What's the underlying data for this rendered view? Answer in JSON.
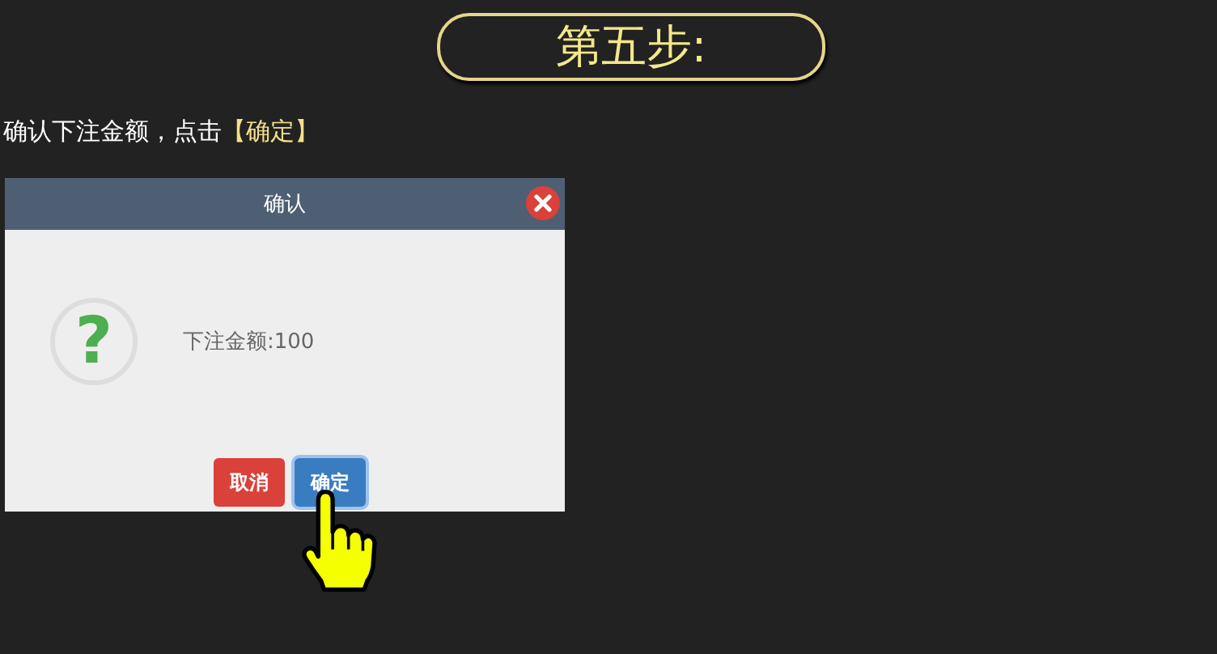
{
  "step_title": "第五步:",
  "instruction": "确认下注金额，点击**【确定】**",
  "dialog": {
    "title": "确认",
    "icon": "?",
    "message": "下注金额:100",
    "buttons": [
      {
        "label": "取消",
        "kind": "cancel"
      },
      {
        "label": "确定",
        "kind": "confirm",
        "focused": true
      }
    ]
  }
}
